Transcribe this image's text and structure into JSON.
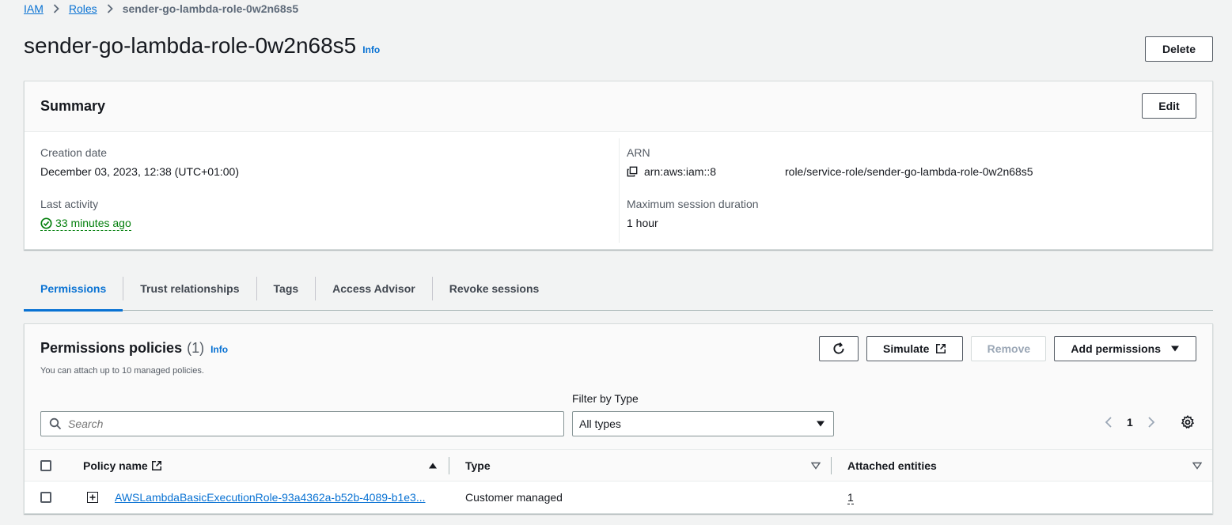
{
  "breadcrumb": {
    "items": [
      "IAM",
      "Roles"
    ],
    "current": "sender-go-lambda-role-0w2n68s5"
  },
  "page": {
    "title": "sender-go-lambda-role-0w2n68s5",
    "info": "Info",
    "delete_label": "Delete"
  },
  "summary": {
    "title": "Summary",
    "edit_label": "Edit",
    "creation_date_label": "Creation date",
    "creation_date": "December 03, 2023, 12:38 (UTC+01:00)",
    "last_activity_label": "Last activity",
    "last_activity": "33 minutes ago",
    "arn_label": "ARN",
    "arn_prefix": "arn:aws:iam::8",
    "arn_suffix": "role/service-role/sender-go-lambda-role-0w2n68s5",
    "max_session_label": "Maximum session duration",
    "max_session": "1 hour"
  },
  "tabs": [
    "Permissions",
    "Trust relationships",
    "Tags",
    "Access Advisor",
    "Revoke sessions"
  ],
  "permissions": {
    "title": "Permissions policies",
    "count": "(1)",
    "info": "Info",
    "subtitle": "You can attach up to 10 managed policies.",
    "simulate_label": "Simulate",
    "remove_label": "Remove",
    "add_label": "Add permissions",
    "filter_label": "Filter by Type",
    "search_placeholder": "Search",
    "filter_value": "All types",
    "page_number": "1",
    "columns": {
      "policy_name": "Policy name",
      "type": "Type",
      "attached": "Attached entities"
    },
    "rows": [
      {
        "policy_name": "AWSLambdaBasicExecutionRole-93a4362a-b52b-4089-b1e3...",
        "type": "Customer managed",
        "attached": "1"
      }
    ]
  },
  "colors": {
    "link": "#0972d3",
    "success": "#037f0c",
    "background": "#f2f3f3"
  }
}
